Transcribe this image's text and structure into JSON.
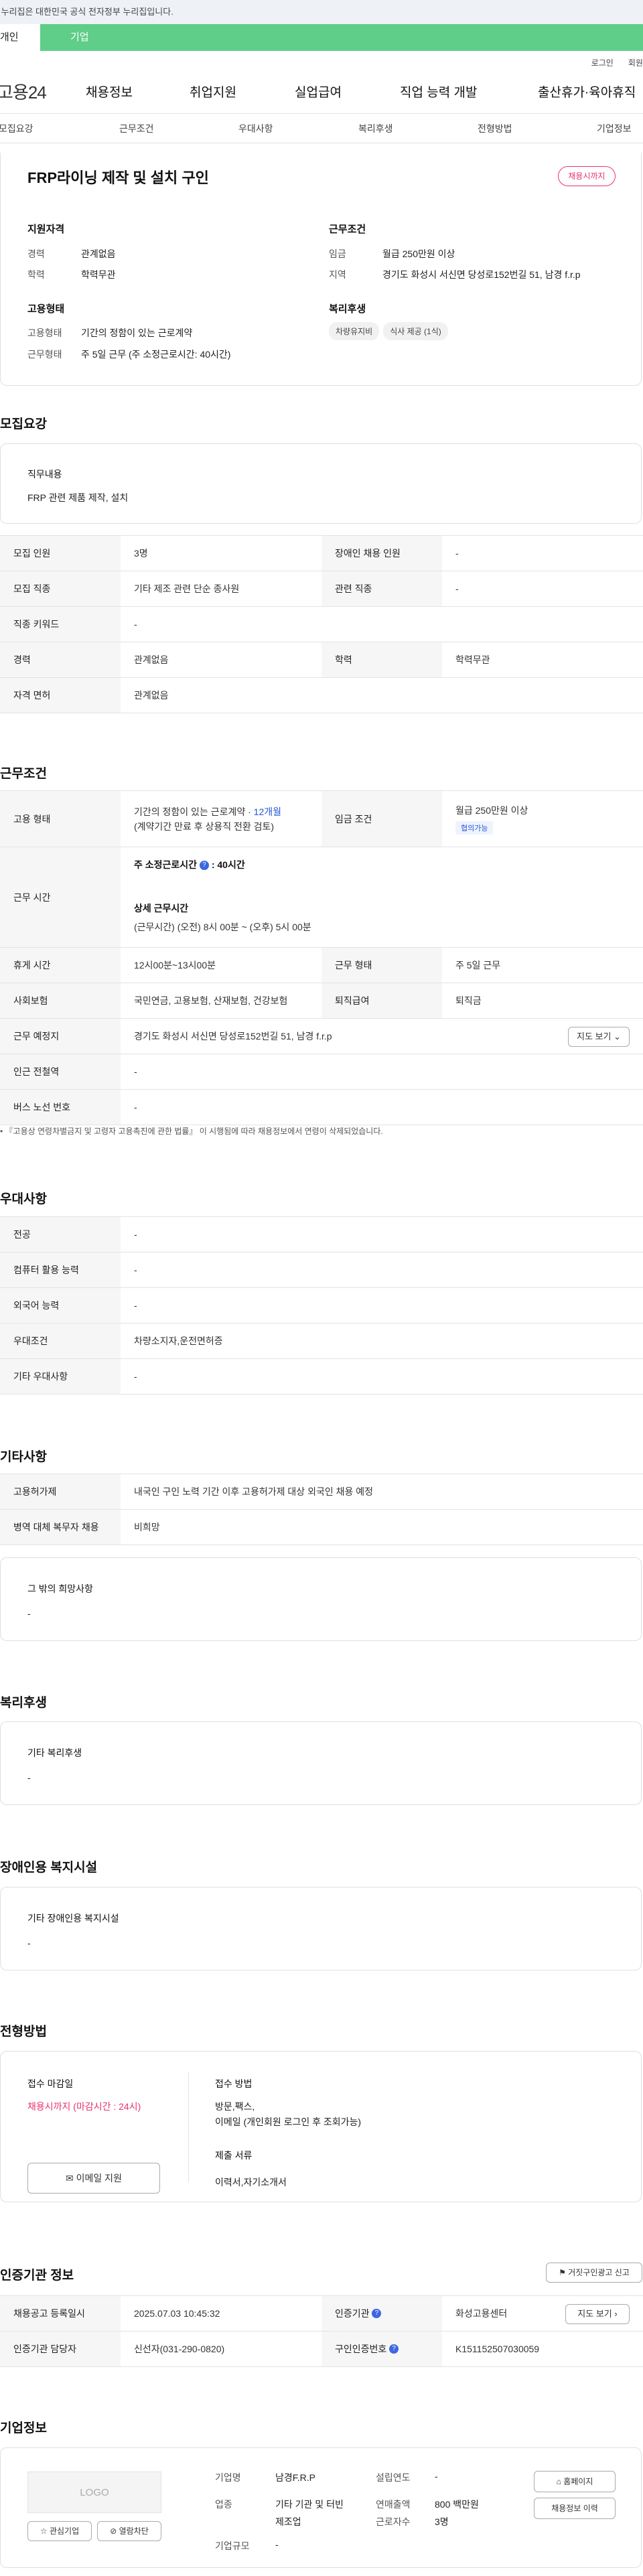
{
  "gov_bar": {
    "text": "이 누리집은 대한민국 공식 전자정부 누리집입니다."
  },
  "top_tabs": [
    "개인",
    "기업"
  ],
  "util_links": [
    "로그인",
    "회원가입"
  ],
  "gnb": {
    "logo": "고용24",
    "menus": [
      "채용정보",
      "취업지원",
      "실업급여",
      "직업 능력 개발",
      "출산휴가·육아휴직"
    ]
  },
  "subnav": [
    "모집요강",
    "근무조건",
    "우대사항",
    "복리후생",
    "전형방법",
    "기업정보"
  ],
  "summary": {
    "title": "FRP라이닝 제작 및 설치 구인",
    "status_button": "채용시까지",
    "qual_title": "지원자격",
    "career_label": "경력",
    "career_value": "관계없음",
    "edu_label": "학력",
    "edu_value": "학력무관",
    "work_title": "근무조건",
    "wage_label": "임금",
    "wage_value": "월급 250만원 이상",
    "region_label": "지역",
    "region_value": "경기도 화성시 서신면 당성로152번길 51, 남경 f.r.p",
    "emp_title": "고용형태",
    "emptype_label": "고용형태",
    "emptype_value": "기간의 정함이 있는 근로계약",
    "hours_label": "근무형태",
    "hours_value": "주 5일 근무 (주 소정근로시간: 40시간)",
    "welfare_title": "복리후생",
    "welfare_chips": [
      "차량유지비",
      "식사 제공 (1식)"
    ]
  },
  "recruit": {
    "heading": "모집요강",
    "duty_title": "직무내용",
    "duty_value": "FRP 관련 제품 제작, 설치",
    "rows": [
      {
        "l1": "모집 인원",
        "v1": "3명",
        "l2": "장애인 채용 인원",
        "v2": "-"
      },
      {
        "l1": "모집 직종",
        "v1": "기타 제조 관련 단순 종사원",
        "l2": "관련 직종",
        "v2": "-"
      },
      {
        "l1": "직종 키워드",
        "v1": "-"
      },
      {
        "l1": "경력",
        "v1": "관계없음",
        "l2": "학력",
        "v2": "학력무관"
      },
      {
        "l1": "자격 면허",
        "v1": "관계없음"
      }
    ]
  },
  "conditions": {
    "heading": "근무조건",
    "emp_label": "고용 형태",
    "emp_value_1": "기간의 정함이 있는 근로계약 · ",
    "emp_value_link": "12개월",
    "emp_value_2": "(계약기간 만료 후 상용직 전환 검토)",
    "wage_label": "임금 조건",
    "wage_value": "월급 250만원 이상",
    "wage_badge": "협의가능",
    "time_label": "근무 시간",
    "time_a_title": "주 소정근로시간",
    "time_a_value": ": 40시간",
    "time_b_title": "상세 근무시간",
    "time_b_value": "(근무시간) (오전) 8시 00분 ~ (오후) 5시 00분",
    "rest_label": "휴게 시간",
    "rest_value": "12시00분~13시00분",
    "form_label": "근무 형태",
    "form_value": "주 5일 근무",
    "ins_label": "사회보험",
    "ins_value": "국민연금, 고용보험, 산재보험, 건강보험",
    "ret_label": "퇴직급여",
    "ret_value": "퇴직금",
    "place_label": "근무 예정지",
    "place_value": "경기도 화성시 서신면 당성로152번길 51, 남경 f.r.p",
    "map_button": "지도 보기",
    "sub_label": "인근 전철역",
    "sub_value": "-",
    "bus_label": "버스 노선 번호",
    "bus_value": "-",
    "note": "『고용상 연령차별금지 및 고령자 고용촉진에 관한 법률』 이 시행됨에 따라 채용정보에서 연령이 삭제되었습니다."
  },
  "prefs": {
    "heading": "우대사항",
    "rows": [
      {
        "l": "전공",
        "v": "-"
      },
      {
        "l": "컴퓨터 활용 능력",
        "v": "-"
      },
      {
        "l": "외국어 능력",
        "v": "-"
      },
      {
        "l": "우대조건",
        "v": "차량소지자,운전면허증"
      },
      {
        "l": "기타 우대사항",
        "v": "-"
      }
    ]
  },
  "etc": {
    "heading": "기타사항",
    "rows": [
      {
        "l": "고용허가제",
        "v": "내국인 구인 노력 기간 이후 고용허가제 대상 외국인 채용 예정"
      },
      {
        "l": "병역 대체 복무자 채용",
        "v": "비희망"
      }
    ],
    "other_title": "그 밖의 희망사항",
    "other_value": "-"
  },
  "welfare": {
    "heading": "복리후생",
    "title": "기타 복리후생",
    "value": "-"
  },
  "disabled": {
    "heading": "장애인용 복지시설",
    "title": "기타 장애인용 복지시설",
    "value": "-"
  },
  "selection": {
    "heading": "전형방법",
    "deadline_title": "접수 마감일",
    "deadline_value": "채용시까지 (마감시간 : 24시)",
    "email_button": "이메일 지원",
    "method_title": "접수 방법",
    "method_value_1": "방문,팩스,",
    "method_value_2": "이메일 (개인회원 로그인 후 조회가능)",
    "docs_title": "제출 서류",
    "docs_value": "이력서,자기소개서"
  },
  "cert": {
    "heading": "인증기관 정보",
    "report_button": "거짓구인광고 신고",
    "reg_label": "채용공고 등록일시",
    "reg_value": "2025.07.03 10:45:32",
    "agency_label": "인증기관",
    "agency_value": "화성고용센터",
    "map_button": "지도 보기",
    "manager_label": "인증기관 담당자",
    "manager_value": "신선자(031-290-0820)",
    "id_label": "구인인증번호",
    "id_value": "K151152507030059"
  },
  "company": {
    "heading": "기업정보",
    "logo": "LOGO",
    "fav_button": "관심기업",
    "block_button": "열람차단",
    "name_label": "기업명",
    "name_value": "남경F.R.P",
    "ind_label": "업종",
    "ind_value_1": "기타 기관 및 터빈",
    "ind_value_2": "제조업",
    "size_label": "기업규모",
    "size_value": "-",
    "year_label": "설립연도",
    "year_value": "-",
    "sales_label": "연매출액",
    "sales_value": "800 백만원",
    "emp_label": "근로자수",
    "emp_value": "3명",
    "home_button": "홈페이지",
    "info_button": "채용정보 이력"
  },
  "colors": {
    "accent_green": "#5ece88",
    "pink": "#e8336e",
    "blue": "#2457d6"
  }
}
